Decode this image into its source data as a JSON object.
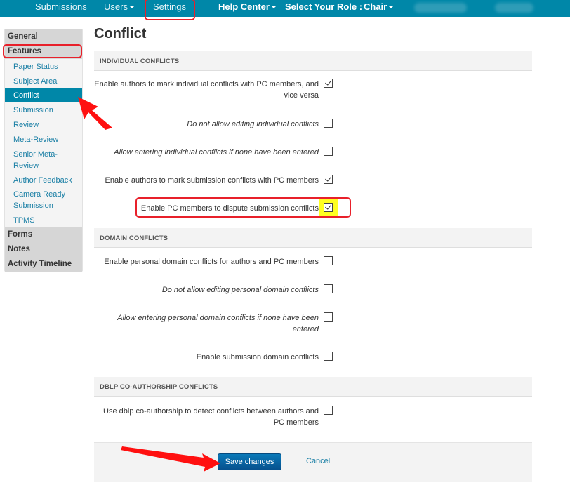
{
  "navbar": {
    "items": [
      {
        "label": "Submissions",
        "has_caret": false
      },
      {
        "label": "Users",
        "has_caret": true
      },
      {
        "label": "Settings",
        "has_caret": false
      },
      {
        "label": "Help Center",
        "has_caret": true
      },
      {
        "label": "Select Your Role :",
        "has_caret": false
      },
      {
        "label": "Chair",
        "has_caret": true
      }
    ],
    "color": "#0087a8"
  },
  "sidebar": {
    "sections": [
      {
        "label": "General"
      },
      {
        "label": "Features"
      },
      {
        "label": "Forms"
      },
      {
        "label": "Notes"
      },
      {
        "label": "Activity Timeline"
      }
    ],
    "feature_items": [
      {
        "label": "Paper Status"
      },
      {
        "label": "Subject Area"
      },
      {
        "label": "Conflict",
        "active": true
      },
      {
        "label": "Submission"
      },
      {
        "label": "Review"
      },
      {
        "label": "Meta-Review"
      },
      {
        "label": "Senior Meta-Review"
      },
      {
        "label": "Author Feedback"
      },
      {
        "label": "Camera Ready Submission"
      },
      {
        "label": "TPMS"
      }
    ]
  },
  "main": {
    "title": "Conflict",
    "sections": [
      {
        "heading": "INDIVIDUAL CONFLICTS",
        "options": [
          {
            "label": "Enable authors to mark individual conflicts with PC members, and vice versa",
            "checked": true,
            "italic": false
          },
          {
            "label": "Do not allow editing individual conflicts",
            "checked": false,
            "italic": true
          },
          {
            "label": "Allow entering individual conflicts if none have been entered",
            "checked": false,
            "italic": true
          },
          {
            "label": "Enable authors to mark submission conflicts with PC members",
            "checked": true,
            "italic": false
          },
          {
            "label": "Enable PC members to dispute submission conflicts",
            "checked": true,
            "italic": false,
            "highlighted": true
          }
        ]
      },
      {
        "heading": "DOMAIN CONFLICTS",
        "options": [
          {
            "label": "Enable personal domain conflicts for authors and PC members",
            "checked": false,
            "italic": false
          },
          {
            "label": "Do not allow editing personal domain conflicts",
            "checked": false,
            "italic": true
          },
          {
            "label": "Allow entering personal domain conflicts if none have been entered",
            "checked": false,
            "italic": true
          },
          {
            "label": "Enable submission domain conflicts",
            "checked": false,
            "italic": false
          }
        ]
      },
      {
        "heading": "DBLP CO-AUTHORSHIP CONFLICTS",
        "options": [
          {
            "label": "Use dblp co-authorship to detect conflicts between authors and PC members",
            "checked": false,
            "italic": false
          }
        ]
      }
    ],
    "save_label": "Save changes",
    "cancel_label": "Cancel"
  },
  "annotations": {
    "box_color": "#e8202a",
    "arrow_color": "#ff0000",
    "highlight_color": "#ffff22"
  }
}
